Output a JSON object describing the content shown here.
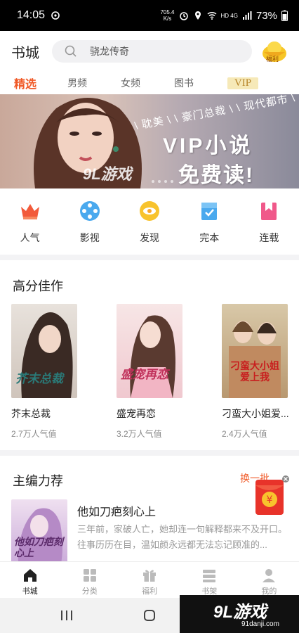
{
  "status_bar": {
    "time": "14:05",
    "speed": "705.4\nK/s",
    "network": "HD 4G",
    "battery": "73%"
  },
  "header": {
    "title": "书城",
    "search_placeholder": "骁龙传奇",
    "fuli_label": "福利"
  },
  "tabs": [
    {
      "label": "精选",
      "active": true
    },
    {
      "label": "男频",
      "active": false
    },
    {
      "label": "女频",
      "active": false
    },
    {
      "label": "图书",
      "active": false
    },
    {
      "label": "VIP",
      "active": false
    }
  ],
  "banner": {
    "tags": "\\ 耽美 \\ \\ 豪门总裁 \\ \\ 现代都市 \\",
    "line1": "VIP小说",
    "line2": "免费读!",
    "watermark": "9L游戏"
  },
  "categories": [
    {
      "label": "人气",
      "icon": "crown-icon"
    },
    {
      "label": "影视",
      "icon": "film-reel-icon"
    },
    {
      "label": "发现",
      "icon": "discover-icon"
    },
    {
      "label": "完本",
      "icon": "finished-book-icon"
    },
    {
      "label": "连载",
      "icon": "bookmark-icon"
    }
  ],
  "high_score": {
    "title": "高分佳作",
    "books": [
      {
        "name": "芥末总裁",
        "popularity": "2.7万人气值",
        "cover_text": "芥末总裁"
      },
      {
        "name": "盛宠再恋",
        "popularity": "3.2万人气值",
        "cover_text": "盛宠再恋"
      },
      {
        "name": "刁蛮大小姐爱...",
        "popularity": "2.4万人气值",
        "cover_text": "刁蛮大小姐爱上我"
      }
    ]
  },
  "editor_rec": {
    "title": "主编力荐",
    "change_label": "换一批",
    "book_title": "他如刀疤刻心上",
    "book_desc": "三年前，家破人亡，她却连一句解释都来不及开口。往事历历在目，温如颜永远都无法忘记顾准的...",
    "cover_text": "他如刀疤刻心上"
  },
  "bottom_nav": [
    {
      "label": "书城",
      "active": true,
      "icon": "home-icon"
    },
    {
      "label": "分类",
      "active": false,
      "icon": "grid-icon"
    },
    {
      "label": "福利",
      "active": false,
      "icon": "gift-icon"
    },
    {
      "label": "书架",
      "active": false,
      "icon": "bookshelf-icon"
    },
    {
      "label": "我的",
      "active": false,
      "icon": "person-icon"
    }
  ],
  "watermark": {
    "logo": "9L游戏",
    "url": "91danji.com"
  },
  "colors": {
    "accent": "#f05a28",
    "vip_bg": "#f6e9b8"
  }
}
